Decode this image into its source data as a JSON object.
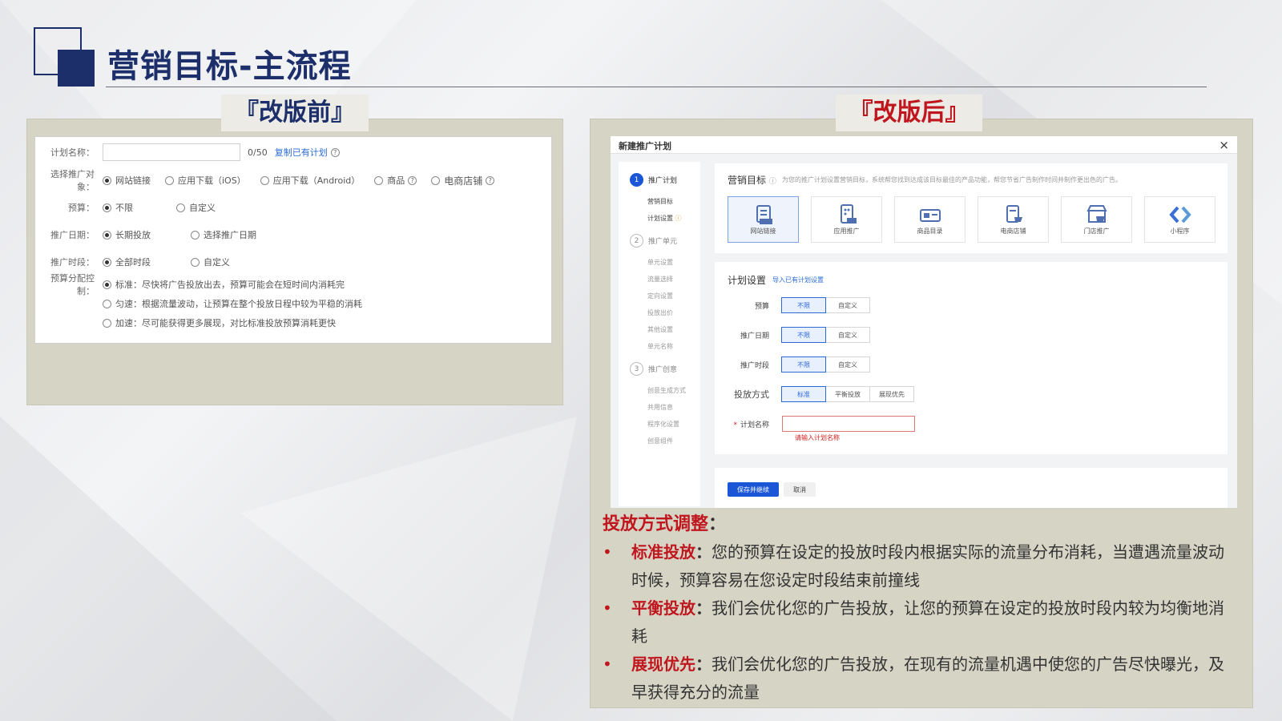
{
  "header": {
    "title": "营销目标-主流程"
  },
  "before": {
    "tag": "『改版前』",
    "form": {
      "plan_name": {
        "label": "计划名称：",
        "value": "",
        "counter": "0/50",
        "link": "复制已有计划"
      },
      "target": {
        "label": "选择推广对象：",
        "options": [
          "网站链接",
          "应用下载（iOS）",
          "应用下载（Android）",
          "商品",
          "电商店铺"
        ],
        "selected": "网站链接"
      },
      "budget": {
        "label": "预算：",
        "options": [
          "不限",
          "自定义"
        ],
        "selected": "不限"
      },
      "date": {
        "label": "推广日期：",
        "options": [
          "长期投放",
          "选择推广日期"
        ],
        "selected": "长期投放"
      },
      "period": {
        "label": "推广时段：",
        "options": [
          "全部时段",
          "自定义"
        ],
        "selected": "全部时段"
      },
      "allocation": {
        "label": "预算分配控制：",
        "options": [
          "标准：尽快将广告投放出去，预算可能会在短时间内消耗完",
          "匀速：根据流量波动，让预算在整个投放日程中较为平稳的消耗",
          "加速：尽可能获得更多展现，对比标准投放预算消耗更快"
        ],
        "selected_index": 0
      }
    }
  },
  "after": {
    "tag": "『改版后』",
    "modal": {
      "title": "新建推广计划",
      "close": "×",
      "steps": [
        {
          "num": "1",
          "label": "推广计划",
          "active": true,
          "subs": [
            "营销目标",
            "计划设置"
          ]
        },
        {
          "num": "2",
          "label": "推广单元",
          "active": false,
          "subs": [
            "单元设置",
            "流量选择",
            "定向设置",
            "投放出价",
            "其他设置",
            "单元名称"
          ]
        },
        {
          "num": "3",
          "label": "推广创意",
          "active": false,
          "subs": [
            "创意生成方式",
            "共用信息",
            "程序化设置",
            "创意组件"
          ]
        }
      ],
      "goal": {
        "title": "营销目标",
        "hint": "为您的推广计划设置营销目标，系统帮您找到达成该目标最佳的产品功能，帮您节省广告制作时间并制作更出色的广告。",
        "tiles": [
          {
            "label": "网站链接",
            "icon": "web-link-icon",
            "selected": true
          },
          {
            "label": "应用推广",
            "icon": "app-promotion-icon",
            "selected": false
          },
          {
            "label": "商品目录",
            "icon": "product-catalog-icon",
            "selected": false
          },
          {
            "label": "电商店铺",
            "icon": "ecommerce-store-icon",
            "selected": false
          },
          {
            "label": "门店推广",
            "icon": "store-promotion-icon",
            "selected": false
          },
          {
            "label": "小程序",
            "icon": "mini-program-icon",
            "selected": false
          }
        ]
      },
      "plan": {
        "title": "计划设置",
        "import_link": "导入已有计划设置",
        "rows": [
          {
            "label": "预算",
            "options": [
              "不限",
              "自定义"
            ],
            "selected": 0
          },
          {
            "label": "推广日期",
            "options": [
              "不限",
              "自定义"
            ],
            "selected": 0
          },
          {
            "label": "推广时段",
            "options": [
              "不限",
              "自定义"
            ],
            "selected": 0
          },
          {
            "label": "投放方式",
            "options": [
              "标准",
              "平衡投放",
              "展现优先"
            ],
            "selected": 0
          }
        ],
        "name": {
          "label": "计划名称",
          "required": "*",
          "value": "",
          "error": "请输入计划名称"
        }
      },
      "save_label": "保存并继续",
      "cancel_label": "取消"
    },
    "explanation": {
      "title": "投放方式调整",
      "title_colon": "：",
      "items": [
        {
          "keyword": "标准投放",
          "text": "您的预算在设定的投放时段内根据实际的流量分布消耗，当遭遇流量波动时候，预算容易在您设定时段结束前撞线"
        },
        {
          "keyword": "平衡投放",
          "text": "我们会优化您的广告投放，让您的预算在设定的投放时段内较为均衡地消耗"
        },
        {
          "keyword": "展现优先",
          "text": "我们会优化您的广告投放，在现有的流量机遇中使您的广告尽快曝光，及早获得充分的流量"
        }
      ]
    }
  },
  "colors": {
    "navy": "#1d2f6b",
    "red": "#c0171f",
    "primary_blue": "#1a56d6",
    "panel_bg": "#d6d4c5"
  }
}
